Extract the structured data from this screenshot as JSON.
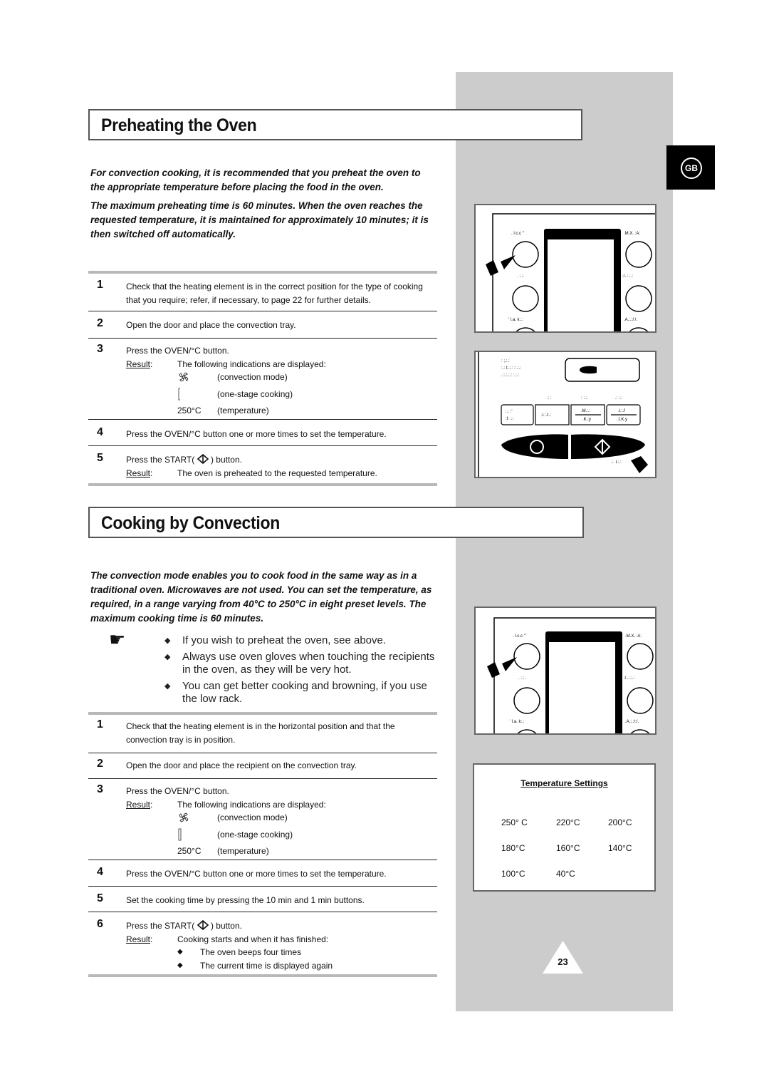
{
  "language_tab": "GB",
  "page_number": "23",
  "preheating": {
    "title": "Preheating the Oven",
    "intro": [
      "For convection cooking, it is recommended that you preheat the oven to the appropriate temperature before placing the food in the oven.",
      "The maximum preheating time is 60 minutes. When the oven reaches the requested temperature, it is maintained for approximately 10 minutes; it is then switched off automatically."
    ],
    "steps": [
      {
        "num": "1",
        "text": "Check that the heating element is in the correct position for the type of cooking that you require; refer, if necessary, to page 22 for further details."
      },
      {
        "num": "2",
        "text": "Open the door and place the convection tray."
      },
      {
        "num": "3",
        "text": "Press the OVEN/°C button.",
        "result_label": "Result",
        "result_text": "The following indications are displayed:",
        "indications": [
          {
            "symbol": "convection-fan-icon",
            "desc": "(convection mode)"
          },
          {
            "symbol": "one-stage-bar-icon",
            "desc": "(one-stage cooking)"
          },
          {
            "symbol": "250°C",
            "desc": "(temperature)"
          }
        ]
      },
      {
        "num": "4",
        "text": "Press the OVEN/°C button one or more times to set the temperature."
      },
      {
        "num": "5",
        "text_before": "Press the START(",
        "text_after": ") button.",
        "result_label": "Result",
        "result_text": "The oven is preheated to the requested temperature."
      }
    ]
  },
  "convection": {
    "title": "Cooking by Convection",
    "intro": "The convection mode enables you to cook food in the same way as in a traditional oven. Microwaves are not used. You can set the temperature, as required, in a range varying from 40°C to 250°C in eight preset levels. The maximum cooking time is 60 minutes.",
    "notes": [
      "If you wish to preheat the oven, see above.",
      "Always use oven gloves when touching the recipients in the oven, as they will be very hot.",
      "You can get better cooking and browning, if you use the low rack."
    ],
    "steps": [
      {
        "num": "1",
        "text": "Check that the heating element is in the horizontal position and that the convection tray is in position."
      },
      {
        "num": "2",
        "text": "Open the door and place the recipient on the convection tray."
      },
      {
        "num": "3",
        "text": "Press the OVEN/°C button.",
        "result_label": "Result",
        "result_text": "The following indications are displayed:",
        "indications": [
          {
            "symbol": "convection-fan-icon",
            "desc": "(convection mode)"
          },
          {
            "symbol": "one-stage-bar-icon",
            "desc": "(one-stage cooking)"
          },
          {
            "symbol": "250°C",
            "desc": "(temperature)"
          }
        ]
      },
      {
        "num": "4",
        "text": "Press the OVEN/°C button one or more times to set the temperature."
      },
      {
        "num": "5",
        "text": "Set the cooking time by pressing the 10 min and 1 min buttons."
      },
      {
        "num": "6",
        "text_before": "Press the START(",
        "text_after": ") button.",
        "result_label": "Result",
        "result_text": "Cooking starts and when it has finished:",
        "bullets": [
          "The oven beeps four times",
          "The current time is displayed again"
        ]
      }
    ]
  },
  "temperature_settings": {
    "title": "Temperature Settings",
    "values": [
      "250° C",
      "220°C",
      "200°C",
      "180°C",
      "160°C",
      "140°C",
      "100°C",
      "40°C"
    ]
  }
}
